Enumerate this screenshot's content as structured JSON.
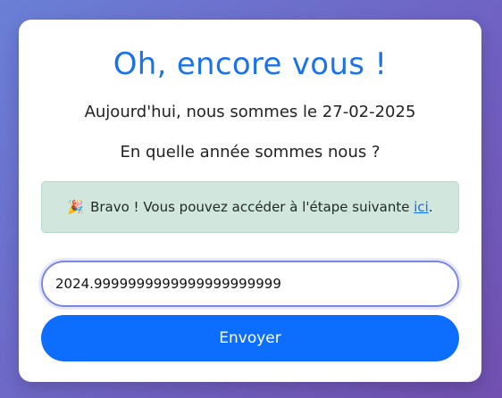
{
  "card": {
    "title": "Oh, encore vous !",
    "date_line": "Aujourd'hui, nous sommes le 27-02-2025",
    "question": "En quelle année sommes nous ?"
  },
  "alert": {
    "icon": "party-popper-icon",
    "emoji": "🎉",
    "text_before": "Bravo ! Vous pouvez accéder à l'étape suivante ",
    "link_label": "ici",
    "text_after": ".",
    "color": "#d1e7dd"
  },
  "form": {
    "input_value": "2024.9999999999999999999999",
    "submit_label": "Envoyer"
  },
  "colors": {
    "accent": "#0d6efd",
    "title": "#1a73e8"
  }
}
